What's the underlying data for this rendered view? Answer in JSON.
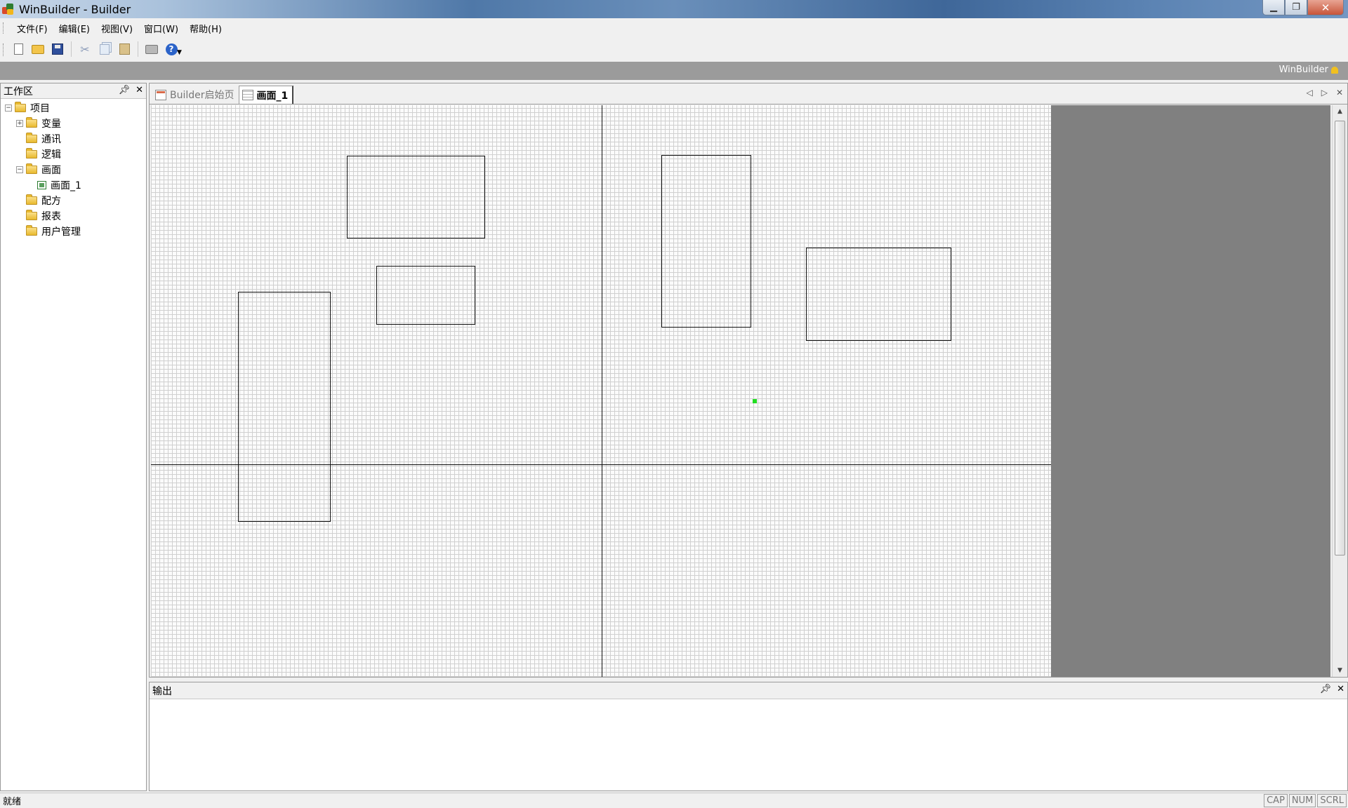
{
  "window": {
    "title": "WinBuilder - Builder"
  },
  "menu": {
    "items": [
      "文件(F)",
      "编辑(E)",
      "视图(V)",
      "窗口(W)",
      "帮助(H)"
    ]
  },
  "toolbar": {
    "icons": [
      "new-file-icon",
      "open-folder-icon",
      "save-icon",
      "cut-icon",
      "copy-icon",
      "paste-icon",
      "print-icon",
      "help-icon"
    ]
  },
  "banner": {
    "label": "WinBuilder"
  },
  "workspace": {
    "title": "工作区",
    "tree": [
      {
        "label": "项目",
        "level": 0,
        "toggle": "−",
        "icon": "folder"
      },
      {
        "label": "变量",
        "level": 1,
        "toggle": "+",
        "icon": "folder"
      },
      {
        "label": "通讯",
        "level": 1,
        "toggle": "",
        "icon": "folder"
      },
      {
        "label": "逻辑",
        "level": 1,
        "toggle": "",
        "icon": "folder"
      },
      {
        "label": "画面",
        "level": 1,
        "toggle": "−",
        "icon": "folder"
      },
      {
        "label": "画面_1",
        "level": 2,
        "toggle": "",
        "icon": "screen"
      },
      {
        "label": "配方",
        "level": 1,
        "toggle": "",
        "icon": "folder"
      },
      {
        "label": "报表",
        "level": 1,
        "toggle": "",
        "icon": "folder"
      },
      {
        "label": "用户管理",
        "level": 1,
        "toggle": "",
        "icon": "folder"
      }
    ]
  },
  "editor": {
    "tabs": [
      {
        "label": "Builder启始页",
        "active": false
      },
      {
        "label": "画面_1",
        "active": true
      }
    ]
  },
  "output": {
    "title": "输出"
  },
  "status": {
    "text": "就绪",
    "keys": [
      "CAP",
      "NUM",
      "SCRL"
    ]
  },
  "colors": {
    "canvas_bg": "#fbfbfb",
    "grid": "#d0d0d0",
    "outer_area": "#808080",
    "marker": "#22dd22"
  }
}
